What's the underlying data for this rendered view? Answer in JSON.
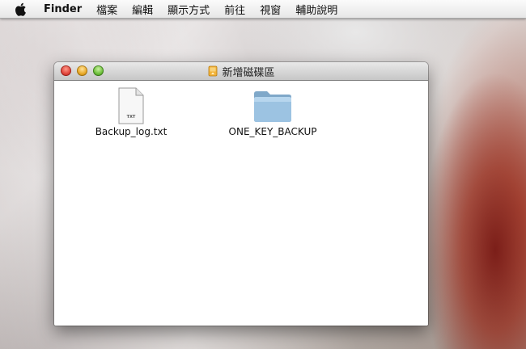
{
  "menubar": {
    "app_name": "Finder",
    "items": [
      "檔案",
      "編輯",
      "顯示方式",
      "前往",
      "視窗",
      "輔助說明"
    ]
  },
  "window": {
    "title": "新增磁碟區",
    "items": [
      {
        "name": "Backup_log.txt",
        "kind": "file",
        "badge": "TXT"
      },
      {
        "name": "ONE_KEY_BACKUP",
        "kind": "folder"
      }
    ]
  },
  "colors": {
    "folder": "#8fb8d8",
    "close": "#e0443b",
    "minimize": "#e8a825",
    "zoom": "#6cbf3a"
  },
  "icons": {
    "apple": "apple-icon",
    "drive": "external-drive-icon",
    "file": "text-file-icon",
    "folder": "folder-icon"
  }
}
